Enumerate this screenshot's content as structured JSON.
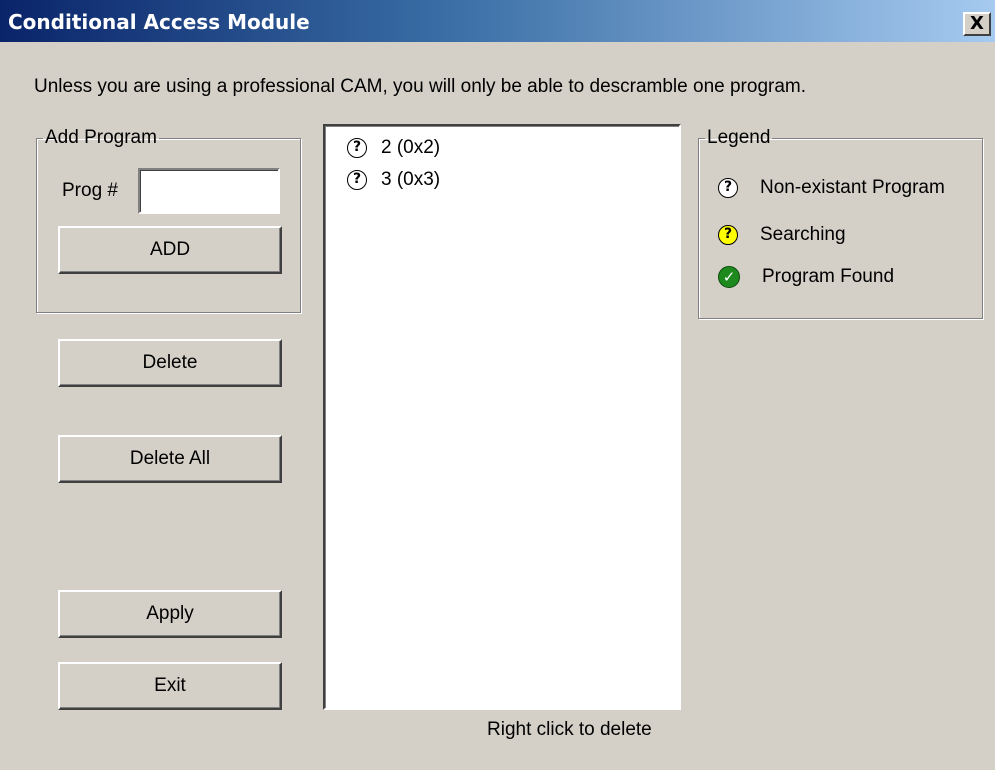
{
  "window": {
    "title": "Conditional Access Module",
    "close_label": "X"
  },
  "info_text": "Unless you are using a professional CAM, you will only be able to descramble one program.",
  "add_program": {
    "group_label": "Add Program",
    "prog_label": "Prog #",
    "prog_value": "",
    "add_button": "ADD"
  },
  "buttons": {
    "delete": "Delete",
    "delete_all": "Delete All",
    "apply": "Apply",
    "exit": "Exit"
  },
  "program_list": {
    "items": [
      {
        "label": "2 (0x2)",
        "status_icon": "question-circle-icon",
        "glyph": "?"
      },
      {
        "label": "3 (0x3)",
        "status_icon": "question-circle-icon",
        "glyph": "?"
      }
    ],
    "hint": "Right click to delete"
  },
  "legend": {
    "group_label": "Legend",
    "items": [
      {
        "label": "Non-existant Program",
        "icon": "question-circle-icon",
        "glyph": "?",
        "color": "#ffffff"
      },
      {
        "label": "Searching",
        "icon": "yellow-question-circle-icon",
        "glyph": "?",
        "color": "#ffff00"
      },
      {
        "label": "Program Found",
        "icon": "green-check-circle-icon",
        "glyph": "✓",
        "color": "#1e8a1e"
      }
    ]
  },
  "colors": {
    "titlebar_start": "#0a246a",
    "titlebar_end": "#a6caf0",
    "dialog_background": "#d4d0c8"
  }
}
